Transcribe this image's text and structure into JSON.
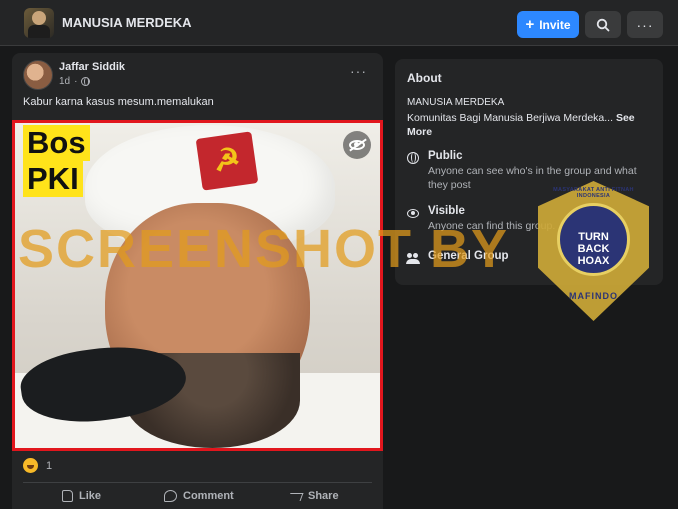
{
  "header": {
    "group_name": "MANUSIA MERDEKA",
    "invite_label": "Invite",
    "icons": [
      "group-avatar",
      "search-icon",
      "more-icon"
    ]
  },
  "post": {
    "author": "Jaffar Siddik",
    "time": "1d",
    "text": "Kabur karna kasus mesum.memalukan",
    "image_caption_line1": "Bos",
    "image_caption_line2": "PKI",
    "reaction_count": "1",
    "actions": {
      "like": "Like",
      "comment": "Comment",
      "share": "Share"
    },
    "image_border_color": "#e1161d"
  },
  "about": {
    "heading": "About",
    "group_name": "MANUSIA MERDEKA",
    "description": "Komunitas Bagi Manusia Berjiwa Merdeka...",
    "see_more": "See More",
    "public_title": "Public",
    "public_desc": "Anyone can see who's in the group and what they post",
    "visible_title": "Visible",
    "visible_desc": "Anyone can find this group.",
    "general_title": "General Group"
  },
  "overlay": {
    "watermark": "SCREENSHOT BY",
    "seal_ring": "MASYARAKAT ANTI FITNAH INDONESIA",
    "seal_center_1": "TURN",
    "seal_center_2": "BACK",
    "seal_center_3": "HOAX",
    "seal_bottom": "MAFINDO"
  },
  "colors": {
    "accent": "#2d88ff",
    "background": "#18191a",
    "card": "#242526",
    "watermark": "#e29b1c"
  }
}
